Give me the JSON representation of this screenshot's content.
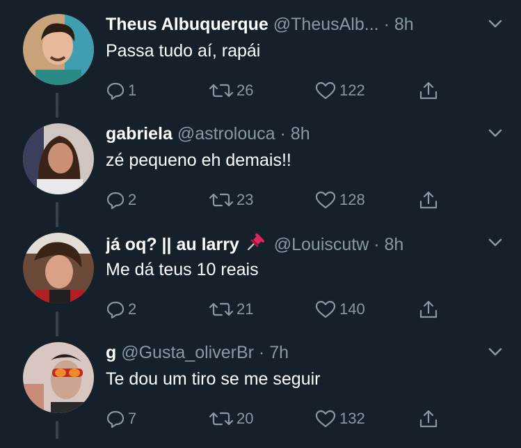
{
  "tweets": [
    {
      "name": "Theus Albuquerque",
      "handle": "@TheusAlb...",
      "time": "8h",
      "text": "Passa tudo aí, rapái",
      "replies": "1",
      "retweets": "26",
      "likes": "122"
    },
    {
      "name": "gabriela",
      "handle": "@astrolouca",
      "time": "8h",
      "text": "zé pequeno eh demais!!",
      "replies": "2",
      "retweets": "23",
      "likes": "128"
    },
    {
      "name": "já oq? || au larry",
      "handle": "@Louiscutw",
      "time": "8h",
      "text": "Me dá teus 10 reais",
      "replies": "2",
      "retweets": "21",
      "likes": "140"
    },
    {
      "name": "g",
      "handle": "@Gusta_oliverBr",
      "time": "7h",
      "text": "Te dou um tiro se me seguir",
      "replies": "7",
      "retweets": "20",
      "likes": "132"
    }
  ],
  "ui": {
    "dot": "·"
  },
  "colors": {
    "background": "#15202b",
    "secondary": "#8899a6",
    "connector": "#38444d",
    "pin": "#e0245e"
  }
}
